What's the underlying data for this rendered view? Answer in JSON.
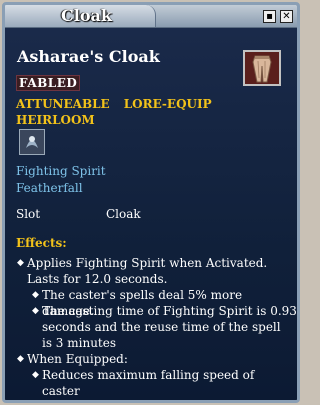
{
  "window": {
    "title": "Cloak",
    "minimize_label": "▪",
    "close_label": "✕"
  },
  "item": {
    "name": "Asharae's Cloak",
    "icon": "cloak-icon",
    "tier": "FABLED",
    "flags": [
      "ATTUNEABLE",
      "LORE-EQUIP",
      "HEIRLOOM"
    ],
    "adornment_icon": "fighting-spirit-icon",
    "spell_names": [
      "Fighting Spirit",
      "Featherfall"
    ],
    "slot_label": "Slot",
    "slot_value": "Cloak"
  },
  "effects": {
    "header": "Effects:",
    "lines": [
      "Applies Fighting Spirit when Activated.",
      "Lasts for 12.0 seconds.",
      "The caster's spells deal 5% more damage.",
      "The casting time of Fighting Spirit is 0.93",
      "seconds and the reuse time of the spell",
      "is 3 minutes",
      "When Equipped:",
      "Reduces maximum falling speed of",
      "caster"
    ]
  },
  "colors": {
    "tier_text": "#ffffff",
    "flags": "#f2c21a",
    "spell_names": "#7fc4ea",
    "background": "#15233f"
  }
}
